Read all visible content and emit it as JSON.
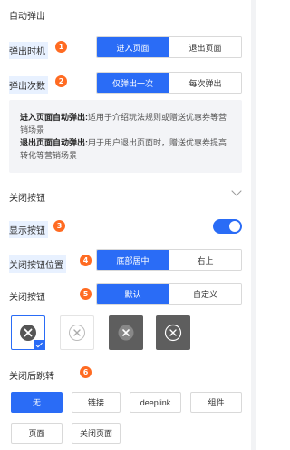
{
  "section_auto": {
    "title": "自动弹出"
  },
  "popup_timing": {
    "label": "弹出时机",
    "badge": "1",
    "options": [
      "进入页面",
      "退出页面"
    ],
    "selected": 0
  },
  "popup_count": {
    "label": "弹出次数",
    "badge": "2",
    "options": [
      "仅弹出一次",
      "每次弹出"
    ],
    "selected": 0
  },
  "notice": {
    "enter_title": "进入页面自动弹出:",
    "enter_text": "适用于介绍玩法规则或赠送优惠券等营销场景",
    "exit_title": "退出页面自动弹出:",
    "exit_text": "用于用户退出页面时，赠送优惠券提高转化等营销场景"
  },
  "section_close": {
    "title": "关闭按钮"
  },
  "show_button": {
    "label": "显示按钮",
    "badge": "3",
    "enabled": true
  },
  "close_position": {
    "label": "关闭按钮位置",
    "badge": "4",
    "options": [
      "底部居中",
      "右上"
    ],
    "selected": 0
  },
  "close_style": {
    "label": "关闭按钮",
    "badge": "5",
    "options": [
      "默认",
      "自定义"
    ],
    "selected": 0,
    "icons": [
      "close-circle-icon",
      "close-circle-outline-icon",
      "close-square-dark-icon",
      "close-circle-dark-icon"
    ],
    "selected_icon": 0
  },
  "after_close": {
    "label": "关闭后跳转",
    "badge": "6",
    "options": [
      "无",
      "链接",
      "deeplink",
      "组件",
      "页面",
      "关闭页面"
    ],
    "selected": 0
  },
  "colors": {
    "accent": "#2a6cf6",
    "badge": "#ff6b22",
    "highlight": "#e8f1ff"
  }
}
